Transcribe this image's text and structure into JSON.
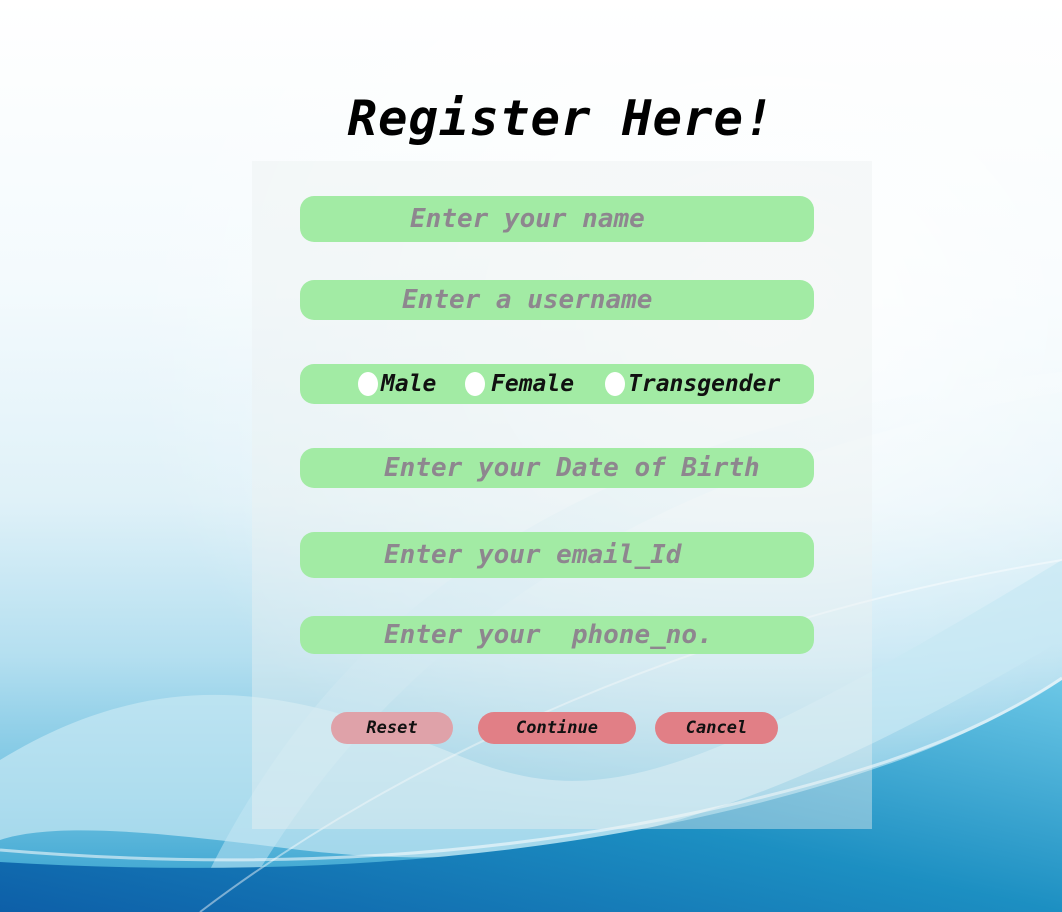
{
  "page": {
    "title": "Register Here!"
  },
  "form": {
    "name_placeholder": "Enter your name",
    "username_placeholder": "Enter a username",
    "gender_options": [
      "Male",
      "Female",
      "Transgender"
    ],
    "dob_placeholder": "Enter your Date of Birth",
    "email_placeholder": "Enter your email_Id",
    "phone_placeholder": "Enter your  phone_no."
  },
  "buttons": {
    "reset_label": "Reset",
    "continue_label": "Continue",
    "cancel_label": "Cancel"
  },
  "colors": {
    "field_fill": "#a2eba4",
    "placeholder_text": "#8e868f",
    "reset_button": "#dfa2a9",
    "action_buttons": "#e17f86",
    "background_blue": "#1c8fc2"
  }
}
